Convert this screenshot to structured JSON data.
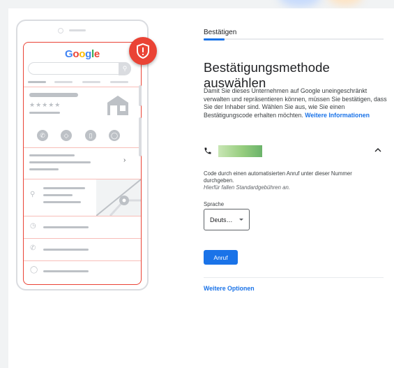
{
  "tab": {
    "label": "Bestätigen"
  },
  "heading": "Bestätigungsmethode auswählen",
  "description": {
    "text": "Damit Sie dieses Unternehmen auf Google uneingeschränkt verwalten und repräsentieren können, müssen Sie bestätigen, dass Sie der Inhaber sind. Wählen Sie aus, wie Sie einen Bestätigungscode erhalten möchten.",
    "link": "Weitere Informationen"
  },
  "phone_method": {
    "call_text": "Code durch einen automatisierten Anruf unter dieser Nummer durchgeben.",
    "fee_note": "Hierfür fallen Standardgebühren an.",
    "language_label": "Sprache",
    "language_value": "Deuts…",
    "call_button": "Anruf"
  },
  "more_options": "Weitere Optionen",
  "illustration": {
    "logo": "Google",
    "rating_stars": "★★★★★"
  },
  "colors": {
    "accent": "#1a73e8",
    "badge": "#ea4335",
    "number_mask": "#96cd7e"
  },
  "icons": [
    "phone-icon",
    "chevron-up-icon",
    "shield-alert-icon",
    "search-icon",
    "location-pin-icon",
    "clock-icon",
    "globe-icon",
    "store-icon",
    "map-icon"
  ]
}
